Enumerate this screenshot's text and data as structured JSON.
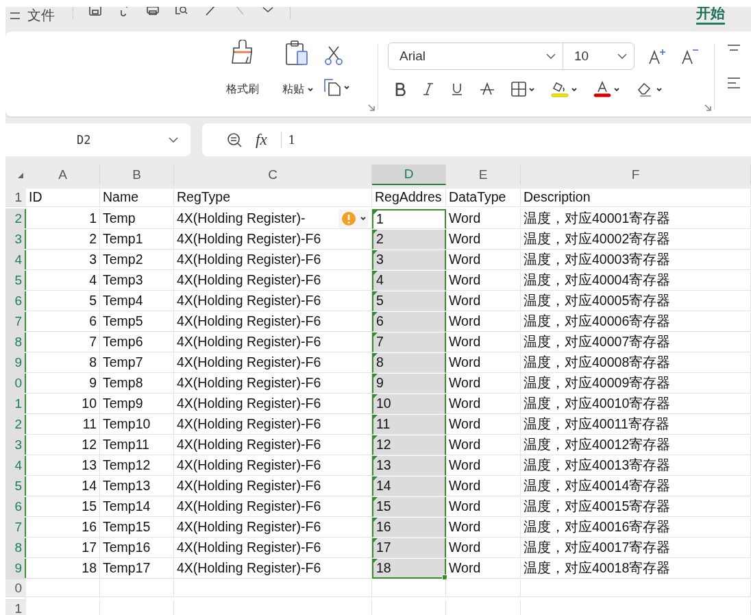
{
  "toolbar": {
    "menu_label": "文件",
    "tab": {
      "label": "开始",
      "selected": true
    }
  },
  "ribbon": {
    "clipboard": [
      {
        "label": "格式刷",
        "has_menu": false
      },
      {
        "label": "粘贴",
        "has_menu": true
      }
    ],
    "font": {
      "name": "Arial",
      "size": "10"
    }
  },
  "formula_bar": {
    "cell_ref": "D2",
    "function_label": "fx",
    "value": "1"
  },
  "sheet": {
    "columns": [
      {
        "label": "A",
        "selected": false
      },
      {
        "label": "B",
        "selected": false
      },
      {
        "label": "C",
        "selected": false
      },
      {
        "label": "D",
        "selected": true
      },
      {
        "label": "E",
        "selected": false
      },
      {
        "label": "F",
        "selected": false
      }
    ],
    "rows": [
      {
        "number": "1",
        "selected": false,
        "active": false,
        "flagged": false,
        "warning": false,
        "cells": [
          "ID",
          "Name",
          "RegType",
          "RegAddres",
          "DataType",
          "Description"
        ]
      },
      {
        "number": "2",
        "selected": true,
        "active": true,
        "flagged": true,
        "warning": true,
        "cells": [
          "1",
          "Temp",
          "4X(Holding Register)-",
          "1",
          "Word",
          "温度，对应40001寄存器"
        ]
      },
      {
        "number": "3",
        "selected": true,
        "active": false,
        "flagged": true,
        "warning": false,
        "cells": [
          "2",
          "Temp1",
          "4X(Holding Register)-F6",
          "2",
          "Word",
          "温度，对应40002寄存器"
        ]
      },
      {
        "number": "4",
        "selected": true,
        "active": false,
        "flagged": true,
        "warning": false,
        "cells": [
          "3",
          "Temp2",
          "4X(Holding Register)-F6",
          "3",
          "Word",
          "温度，对应40003寄存器"
        ]
      },
      {
        "number": "5",
        "selected": true,
        "active": false,
        "flagged": true,
        "warning": false,
        "cells": [
          "4",
          "Temp3",
          "4X(Holding Register)-F6",
          "4",
          "Word",
          "温度，对应40004寄存器"
        ]
      },
      {
        "number": "6",
        "selected": true,
        "active": false,
        "flagged": true,
        "warning": false,
        "cells": [
          "5",
          "Temp4",
          "4X(Holding Register)-F6",
          "5",
          "Word",
          "温度，对应40005寄存器"
        ]
      },
      {
        "number": "7",
        "selected": true,
        "active": false,
        "flagged": true,
        "warning": false,
        "cells": [
          "6",
          "Temp5",
          "4X(Holding Register)-F6",
          "6",
          "Word",
          "温度，对应40006寄存器"
        ]
      },
      {
        "number": "8",
        "selected": true,
        "active": false,
        "flagged": true,
        "warning": false,
        "cells": [
          "7",
          "Temp6",
          "4X(Holding Register)-F6",
          "7",
          "Word",
          "温度，对应40007寄存器"
        ]
      },
      {
        "number": "9",
        "selected": true,
        "active": false,
        "flagged": true,
        "warning": false,
        "cells": [
          "8",
          "Temp7",
          "4X(Holding Register)-F6",
          "8",
          "Word",
          "温度，对应40008寄存器"
        ]
      },
      {
        "number": "0",
        "selected": true,
        "active": false,
        "flagged": true,
        "warning": false,
        "cells": [
          "9",
          "Temp8",
          "4X(Holding Register)-F6",
          "9",
          "Word",
          "温度，对应40009寄存器"
        ]
      },
      {
        "number": "1",
        "selected": true,
        "active": false,
        "flagged": true,
        "warning": false,
        "cells": [
          "10",
          "Temp9",
          "4X(Holding Register)-F6",
          "10",
          "Word",
          "温度，对应40010寄存器"
        ]
      },
      {
        "number": "2",
        "selected": true,
        "active": false,
        "flagged": true,
        "warning": false,
        "cells": [
          "11",
          "Temp10",
          "4X(Holding Register)-F6",
          "11",
          "Word",
          "温度，对应40011寄存器"
        ]
      },
      {
        "number": "3",
        "selected": true,
        "active": false,
        "flagged": true,
        "warning": false,
        "cells": [
          "12",
          "Temp11",
          "4X(Holding Register)-F6",
          "12",
          "Word",
          "温度，对应40012寄存器"
        ]
      },
      {
        "number": "4",
        "selected": true,
        "active": false,
        "flagged": true,
        "warning": false,
        "cells": [
          "13",
          "Temp12",
          "4X(Holding Register)-F6",
          "13",
          "Word",
          "温度，对应40013寄存器"
        ]
      },
      {
        "number": "5",
        "selected": true,
        "active": false,
        "flagged": true,
        "warning": false,
        "cells": [
          "14",
          "Temp13",
          "4X(Holding Register)-F6",
          "14",
          "Word",
          "温度，对应40014寄存器"
        ]
      },
      {
        "number": "6",
        "selected": true,
        "active": false,
        "flagged": true,
        "warning": false,
        "cells": [
          "15",
          "Temp14",
          "4X(Holding Register)-F6",
          "15",
          "Word",
          "温度，对应40015寄存器"
        ]
      },
      {
        "number": "7",
        "selected": true,
        "active": false,
        "flagged": true,
        "warning": false,
        "cells": [
          "16",
          "Temp15",
          "4X(Holding Register)-F6",
          "16",
          "Word",
          "温度，对应40016寄存器"
        ]
      },
      {
        "number": "8",
        "selected": true,
        "active": false,
        "flagged": true,
        "warning": false,
        "cells": [
          "17",
          "Temp16",
          "4X(Holding Register)-F6",
          "17",
          "Word",
          "温度，对应40017寄存器"
        ]
      },
      {
        "number": "9",
        "selected": true,
        "active": false,
        "flagged": true,
        "warning": false,
        "cells": [
          "18",
          "Temp17",
          "4X(Holding Register)-F6",
          "18",
          "Word",
          "温度，对应40018寄存器"
        ]
      },
      {
        "number": "0",
        "selected": false,
        "active": false,
        "flagged": false,
        "warning": false
      },
      {
        "number": "1",
        "selected": false,
        "active": false,
        "flagged": false,
        "warning": false
      }
    ]
  }
}
